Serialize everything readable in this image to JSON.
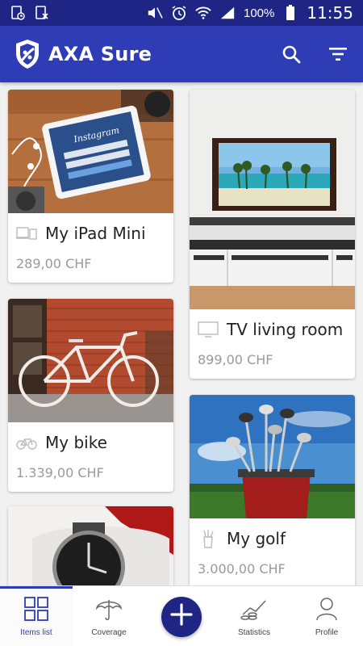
{
  "status_bar": {
    "battery": "100%",
    "time": "11:55",
    "color": "#1f2585"
  },
  "app_bar": {
    "title": "AXA Sure",
    "color": "#2e3cb6",
    "actions": [
      "search-icon",
      "filter-icon"
    ]
  },
  "items": [
    {
      "name": "My iPad Mini",
      "price": "289,00 CHF",
      "icon": "tablet-icon"
    },
    {
      "name": "TV living room",
      "price": "899,00 CHF",
      "icon": "tv-icon"
    },
    {
      "name": "My bike",
      "price": "1.339,00 CHF",
      "icon": "bike-icon"
    },
    {
      "name": "My golf",
      "price": "3.000,00 CHF",
      "icon": "golf-icon"
    },
    {
      "name": "",
      "price": "",
      "icon": "watch-icon"
    }
  ],
  "bottom_nav": {
    "items": [
      {
        "label": "Items list",
        "icon": "grid-icon",
        "active": true
      },
      {
        "label": "Coverage",
        "icon": "umbrella-icon",
        "active": false
      },
      {
        "label": "",
        "icon": "add-icon",
        "active": false
      },
      {
        "label": "Statistics",
        "icon": "chart-icon",
        "active": false
      },
      {
        "label": "Profile",
        "icon": "person-icon",
        "active": false
      }
    ]
  }
}
